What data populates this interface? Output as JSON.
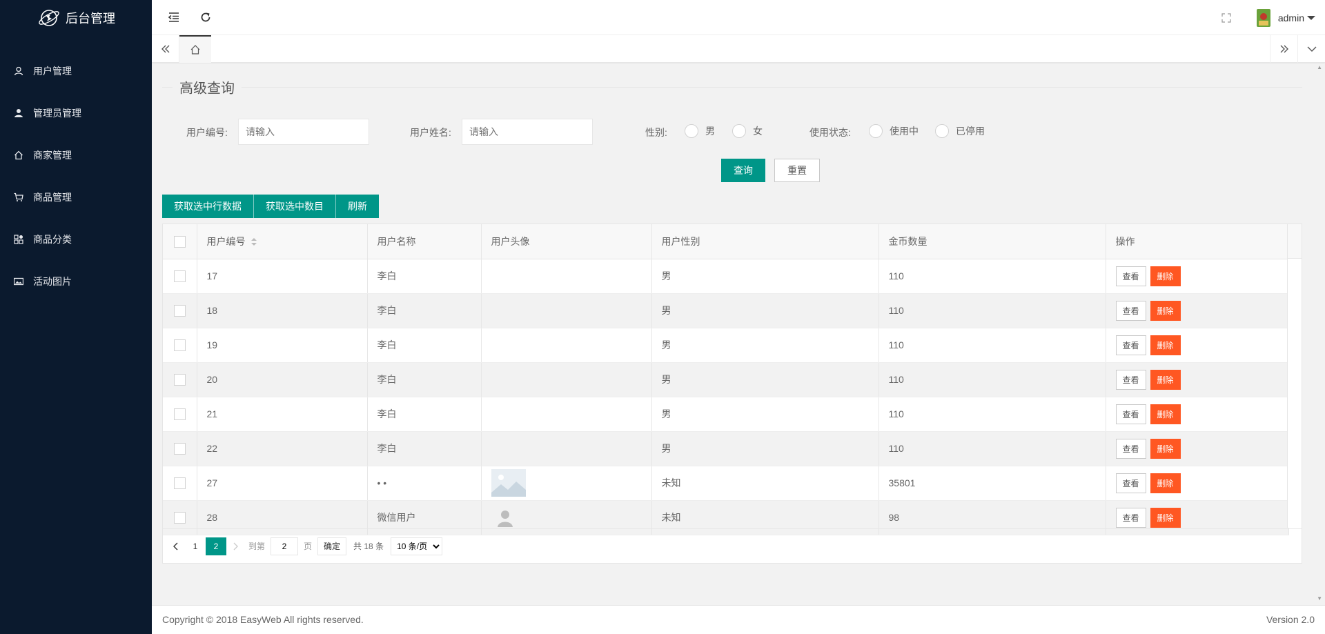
{
  "app": {
    "title": "后台管理"
  },
  "sidebar": {
    "items": [
      {
        "label": "用户管理",
        "icon": "user-icon"
      },
      {
        "label": "管理员管理",
        "icon": "admin-icon"
      },
      {
        "label": "商家管理",
        "icon": "home-icon"
      },
      {
        "label": "商品管理",
        "icon": "cart-icon"
      },
      {
        "label": "商品分类",
        "icon": "apps-icon"
      },
      {
        "label": "活动图片",
        "icon": "picture-icon"
      }
    ]
  },
  "header": {
    "user": "admin"
  },
  "search": {
    "legend": "高级查询",
    "user_id_label": "用户编号:",
    "user_id_placeholder": "请输入",
    "user_name_label": "用户姓名:",
    "user_name_placeholder": "请输入",
    "gender_label": "性别:",
    "gender_options": [
      "男",
      "女"
    ],
    "status_label": "使用状态:",
    "status_options": [
      "使用中",
      "已停用"
    ],
    "query_button": "查询",
    "reset_button": "重置"
  },
  "toolbar": {
    "get_row_data": "获取选中行数据",
    "get_count": "获取选中数目",
    "refresh": "刷新"
  },
  "table": {
    "columns": [
      "用户编号",
      "用户名称",
      "用户头像",
      "用户性别",
      "金币数量",
      "操作"
    ],
    "view_label": "查看",
    "delete_label": "删除",
    "rows": [
      {
        "id": "17",
        "name": "李白",
        "avatar": "",
        "gender": "男",
        "coins": "110"
      },
      {
        "id": "18",
        "name": "李白",
        "avatar": "",
        "gender": "男",
        "coins": "110"
      },
      {
        "id": "19",
        "name": "李白",
        "avatar": "",
        "gender": "男",
        "coins": "110"
      },
      {
        "id": "20",
        "name": "李白",
        "avatar": "",
        "gender": "男",
        "coins": "110"
      },
      {
        "id": "21",
        "name": "李白",
        "avatar": "",
        "gender": "男",
        "coins": "110"
      },
      {
        "id": "22",
        "name": "李白",
        "avatar": "",
        "gender": "男",
        "coins": "110"
      },
      {
        "id": "27",
        "name": "• •",
        "avatar": "image-placeholder-icon",
        "gender": "未知",
        "coins": "35801"
      },
      {
        "id": "28",
        "name": "微信用户",
        "avatar": "default-user-icon",
        "gender": "未知",
        "coins": "98"
      }
    ]
  },
  "pagination": {
    "pages": [
      "1",
      "2"
    ],
    "current": "2",
    "goto_label": "到第",
    "goto_value": "2",
    "page_unit": "页",
    "confirm": "确定",
    "total": "共 18 条",
    "page_size": "10 条/页"
  },
  "footer": {
    "copyright": "Copyright © 2018 EasyWeb All rights reserved.",
    "version": "Version 2.0"
  },
  "colors": {
    "sidebar": "#0b1a2e",
    "primary": "#009688",
    "danger": "#ff5722"
  }
}
